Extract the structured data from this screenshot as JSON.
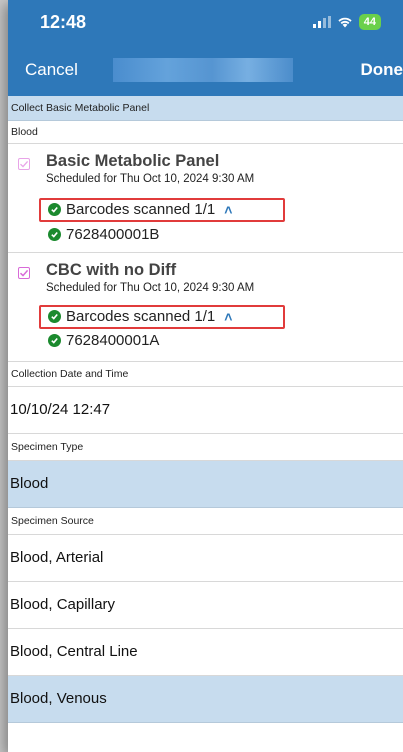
{
  "status_bar": {
    "time": "12:48",
    "battery": "44"
  },
  "nav": {
    "cancel_label": "Cancel",
    "done_label": "Done"
  },
  "collect_title": "Collect Basic Metabolic Panel",
  "group_label": "Blood",
  "orders": [
    {
      "name": "Basic Metabolic Panel",
      "scheduled": "Scheduled for Thu Oct 10, 2024  9:30 AM",
      "scan_status": "Barcodes scanned 1/1",
      "barcode": "7628400001B",
      "checked": false
    },
    {
      "name": "CBC with no Diff",
      "scheduled": "Scheduled for Thu Oct 10, 2024  9:30 AM",
      "scan_status": "Barcodes scanned 1/1",
      "barcode": "7628400001A",
      "checked": true
    }
  ],
  "collection": {
    "label": "Collection Date and Time",
    "value": "10/10/24 12:47"
  },
  "specimen_type": {
    "label": "Specimen Type",
    "value": "Blood"
  },
  "specimen_source": {
    "label": "Specimen Source",
    "options": [
      "Blood, Arterial",
      "Blood, Capillary",
      "Blood, Central Line",
      "Blood, Venous"
    ],
    "selected": "Blood, Venous"
  },
  "colors": {
    "header": "#2e78b9",
    "selection": "#c7dcee",
    "highlight": "#e13b3b",
    "success": "#1b8a2e",
    "checkbox": "#d86ad8"
  },
  "icons": [
    "signal-icon",
    "wifi-icon",
    "battery-icon",
    "checkbox-icon",
    "check-circle-icon",
    "chevron-up-double-icon"
  ]
}
